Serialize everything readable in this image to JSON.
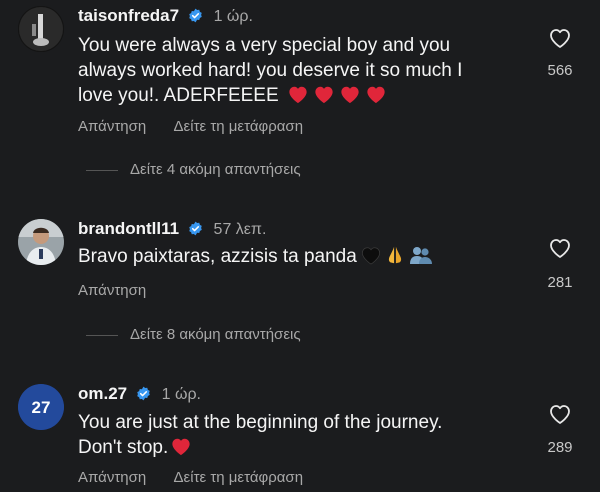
{
  "comments": [
    {
      "username": "taisonfreda7",
      "time": "1 ώρ.",
      "text_lines": [
        "You were always a very special boy and you",
        "always worked hard! you deserve it so much I",
        "love you!. ADERFEEEE"
      ],
      "hearts_count": 4,
      "likes": "566",
      "reply_label": "Απάντηση",
      "translate_label": "Δείτε τη μετάφραση",
      "more_replies": "Δείτε 4 ακόμη απαντήσεις"
    },
    {
      "username": "brandontll11",
      "time": "57 λεπ.",
      "text_lines": [
        "Bravo paixtaras, azzisis ta panda"
      ],
      "likes": "281",
      "reply_label": "Απάντηση",
      "more_replies": "Δείτε 8 ακόμη απαντήσεις"
    },
    {
      "username": "om.27",
      "time": "1 ώρ.",
      "avatar_text": "27",
      "text_lines": [
        "You are just at the beginning of the journey.",
        "Don't stop."
      ],
      "likes": "289",
      "reply_label": "Απάντηση",
      "translate_label": "Δείτε τη μετάφραση"
    }
  ],
  "colors": {
    "background": "#1b1c1e",
    "verified": "#3897f0",
    "heart": "#e0263a",
    "secondary_text": "#a8a8a8"
  }
}
